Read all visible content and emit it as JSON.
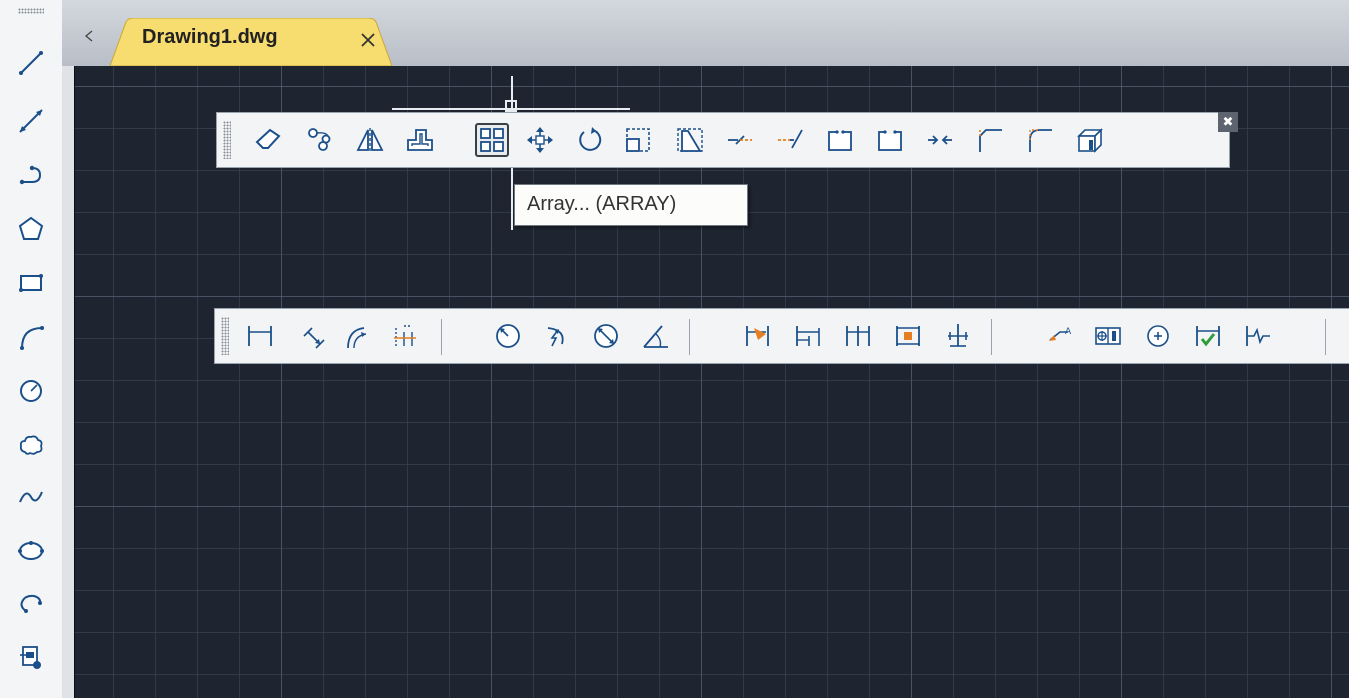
{
  "document_tab": {
    "title": "Drawing1.dwg",
    "close_glyph": "×",
    "accent_color": "#f7dc6f"
  },
  "tooltip": {
    "text": "Array... (ARRAY)"
  },
  "draw_toolbar": {
    "tools": [
      {
        "icon": "line-icon"
      },
      {
        "icon": "construction-line-icon"
      },
      {
        "icon": "polyline-icon"
      },
      {
        "icon": "polygon-icon"
      },
      {
        "icon": "rectangle-icon"
      },
      {
        "icon": "arc-icon"
      },
      {
        "icon": "circle-icon"
      },
      {
        "icon": "revision-cloud-icon"
      },
      {
        "icon": "spline-icon"
      },
      {
        "icon": "ellipse-icon"
      },
      {
        "icon": "ellipse-arc-icon"
      },
      {
        "icon": "insert-block-icon"
      }
    ]
  },
  "modify_toolbar": {
    "close_glyph": "✖",
    "tools": [
      {
        "icon": "erase-icon"
      },
      {
        "icon": "copy-icon"
      },
      {
        "icon": "mirror-icon"
      },
      {
        "icon": "offset-icon"
      },
      {
        "icon": "array-icon",
        "active": true
      },
      {
        "icon": "move-icon"
      },
      {
        "icon": "rotate-icon"
      },
      {
        "icon": "scale-icon"
      },
      {
        "icon": "stretch-icon"
      },
      {
        "icon": "trim-icon"
      },
      {
        "icon": "extend-icon"
      },
      {
        "icon": "break-at-point-icon"
      },
      {
        "icon": "break-icon"
      },
      {
        "icon": "join-icon"
      },
      {
        "icon": "chamfer-icon"
      },
      {
        "icon": "fillet-icon"
      },
      {
        "icon": "explode-icon"
      }
    ]
  },
  "dimension_toolbar": {
    "tools": [
      {
        "icon": "linear-dimension-icon"
      },
      {
        "icon": "aligned-dimension-icon"
      },
      {
        "icon": "arc-length-icon"
      },
      {
        "icon": "ordinate-dimension-icon"
      },
      {
        "icon": "radius-dimension-icon"
      },
      {
        "icon": "jogged-dimension-icon"
      },
      {
        "icon": "diameter-dimension-icon"
      },
      {
        "icon": "angular-dimension-icon"
      },
      {
        "icon": "quick-dimension-icon"
      },
      {
        "icon": "baseline-dimension-icon"
      },
      {
        "icon": "continue-dimension-icon"
      },
      {
        "icon": "dimension-space-icon"
      },
      {
        "icon": "dimension-break-icon"
      },
      {
        "icon": "leader-icon"
      },
      {
        "icon": "tolerance-icon"
      },
      {
        "icon": "center-mark-icon"
      },
      {
        "icon": "inspection-icon"
      },
      {
        "icon": "jogged-linear-icon"
      }
    ]
  },
  "colors": {
    "canvas": "#1e2430",
    "toolbar": "#f2f4f6",
    "icon_blue": "#1b4f8a",
    "icon_orange": "#e67e22",
    "icon_green": "#2e9e3a"
  }
}
